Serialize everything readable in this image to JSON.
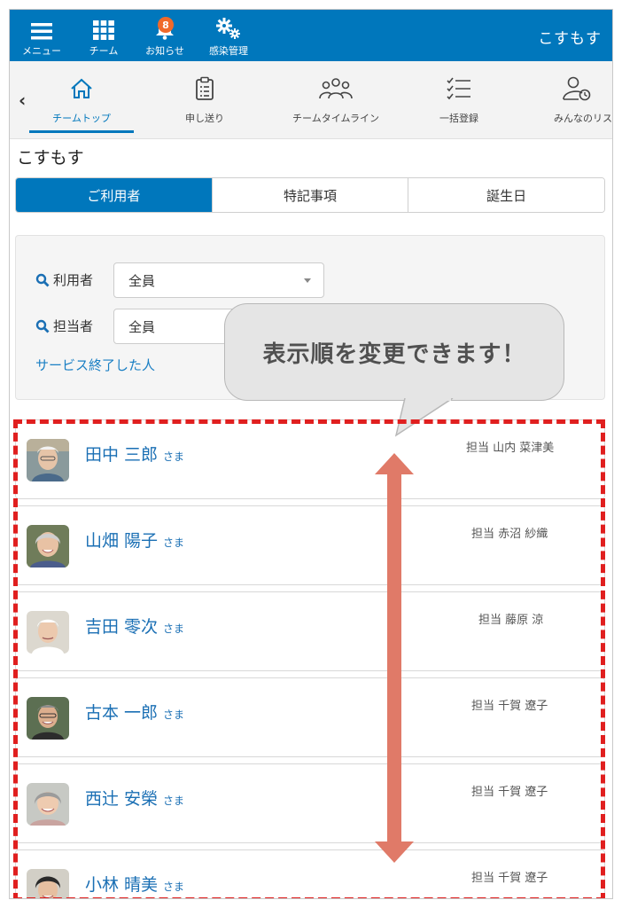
{
  "topbar": {
    "menu_label": "メニュー",
    "team_label": "チーム",
    "notice_label": "お知らせ",
    "notice_count": "8",
    "infection_label": "感染管理",
    "facility_name": "こすもす",
    "color": "#0077bc"
  },
  "nav": {
    "back": "‹",
    "items": [
      {
        "label": "チームトップ",
        "icon": "home-icon",
        "active": true
      },
      {
        "label": "申し送り",
        "icon": "clipboard-icon"
      },
      {
        "label": "チームタイムライン",
        "icon": "group-icon"
      },
      {
        "label": "一括登録",
        "icon": "checklist-icon"
      },
      {
        "label": "みんなのリス",
        "icon": "user-clock-icon"
      }
    ]
  },
  "page_title": "こすもす",
  "tabs": [
    {
      "label": "ご利用者",
      "active": true
    },
    {
      "label": "特記事項"
    },
    {
      "label": "誕生日"
    }
  ],
  "filter": {
    "user_label": "利用者",
    "user_value": "全員",
    "staff_label": "担当者",
    "staff_value": "全員",
    "ended_link": "サービス終了した人"
  },
  "callout": "表示順を変更できます！",
  "residents": [
    {
      "name": "田中 三郎",
      "suffix": "さま",
      "staff": "担当 山内 菜津美"
    },
    {
      "name": "山畑 陽子",
      "suffix": "さま",
      "staff": "担当 赤沼 紗織"
    },
    {
      "name": "吉田 零次",
      "suffix": "さま",
      "staff": "担当 藤原 涼"
    },
    {
      "name": "古本 一郎",
      "suffix": "さま",
      "staff": "担当 千賀 遼子"
    },
    {
      "name": "西辻 安榮",
      "suffix": "さま",
      "staff": "担当 千賀 遼子"
    },
    {
      "name": "小林 晴美",
      "suffix": "さま",
      "staff": "担当 千賀 遼子"
    }
  ]
}
